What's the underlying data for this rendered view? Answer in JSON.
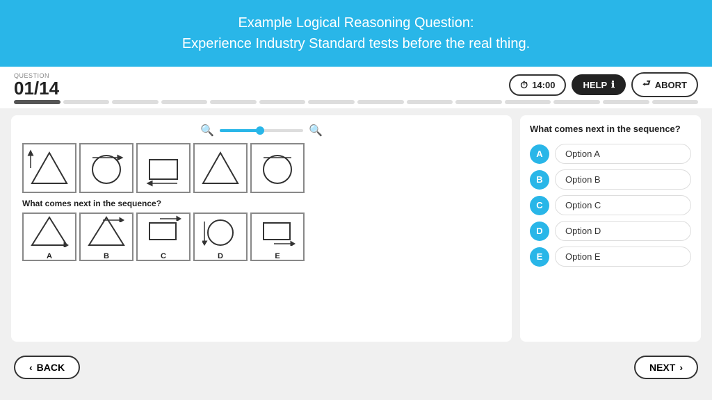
{
  "header": {
    "line1": "Example Logical Reasoning Question:",
    "line2": "Experience Industry Standard tests before the real thing."
  },
  "question_bar": {
    "label": "QUESTION",
    "number": "01/14",
    "timer": "14:00",
    "help_label": "HELP",
    "abort_label": "ABORT"
  },
  "progress": {
    "total": 14,
    "filled": 1
  },
  "left": {
    "sequence_label": "What comes next in the sequence?",
    "options": [
      "A",
      "B",
      "C",
      "D",
      "E"
    ]
  },
  "right": {
    "question": "What comes next in the sequence?",
    "options": [
      {
        "id": "A",
        "label": "Option A"
      },
      {
        "id": "B",
        "label": "Option B"
      },
      {
        "id": "C",
        "label": "Option C"
      },
      {
        "id": "D",
        "label": "Option D"
      },
      {
        "id": "E",
        "label": "Option E"
      }
    ]
  },
  "footer": {
    "back_label": "BACK",
    "next_label": "NEXT"
  }
}
